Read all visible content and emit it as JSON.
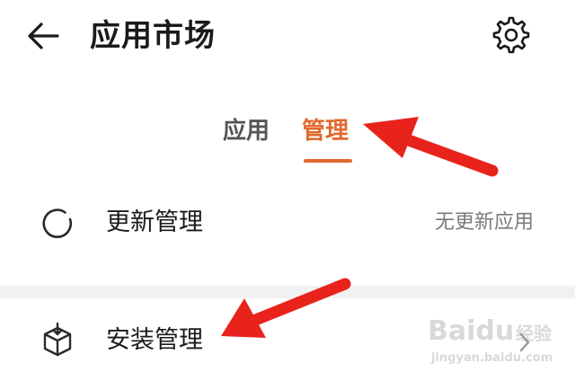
{
  "header": {
    "title": "应用市场",
    "back_icon": "arrow-left-icon",
    "settings_icon": "gear-icon"
  },
  "tabs": [
    {
      "label": "应用",
      "active": false
    },
    {
      "label": "管理",
      "active": true
    }
  ],
  "rows": [
    {
      "label": "更新管理",
      "status": "无更新应用",
      "icon": "refresh-icon"
    },
    {
      "label": "安装管理",
      "icon": "package-download-icon"
    }
  ],
  "accent_color": "#e06a2e",
  "annotation_color": "#e8231c",
  "watermark": {
    "brand": "Baidu",
    "sub": "经验",
    "url": "jingyan.baidu.com"
  }
}
